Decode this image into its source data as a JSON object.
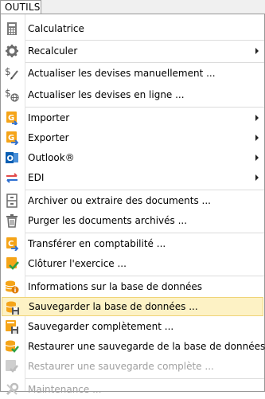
{
  "menubar": {
    "title": "OUTILS"
  },
  "items": [
    {
      "label": "Calculatrice",
      "icon": "calculator-icon",
      "submenu": false,
      "disabled": false
    },
    {
      "label": "Recalculer",
      "icon": "gear-icon",
      "submenu": true,
      "disabled": false
    },
    {
      "label": "Actualiser les devises manuellement ...",
      "icon": "currency-edit-icon",
      "submenu": false,
      "disabled": false
    },
    {
      "label": "Actualiser les devises en ligne ...",
      "icon": "currency-online-icon",
      "submenu": false,
      "disabled": false
    },
    {
      "label": "Importer",
      "icon": "import-icon",
      "submenu": true,
      "disabled": false
    },
    {
      "label": "Exporter",
      "icon": "export-icon",
      "submenu": true,
      "disabled": false
    },
    {
      "label": "Outlook®",
      "icon": "outlook-icon",
      "submenu": true,
      "disabled": false
    },
    {
      "label": "EDI",
      "icon": "edi-icon",
      "submenu": true,
      "disabled": false
    },
    {
      "label": "Archiver ou extraire des documents ...",
      "icon": "archive-icon",
      "submenu": false,
      "disabled": false
    },
    {
      "label": "Purger les documents archivés ...",
      "icon": "trash-icon",
      "submenu": false,
      "disabled": false
    },
    {
      "label": "Transférer en comptabilité ...",
      "icon": "transfer-accounting-icon",
      "submenu": false,
      "disabled": false
    },
    {
      "label": "Clôturer l'exercice ...",
      "icon": "close-fiscal-year-icon",
      "submenu": false,
      "disabled": false
    },
    {
      "label": "Informations sur la base de données",
      "icon": "database-info-icon",
      "submenu": false,
      "disabled": false
    },
    {
      "label": "Sauvegarder la base de données ...",
      "icon": "database-save-icon",
      "submenu": false,
      "disabled": false,
      "highlighted": true
    },
    {
      "label": "Sauvegarder complètement ...",
      "icon": "full-backup-icon",
      "submenu": false,
      "disabled": false
    },
    {
      "label": "Restaurer une sauvegarde de la base de données ...",
      "icon": "database-restore-icon",
      "submenu": false,
      "disabled": false
    },
    {
      "label": "Restaurer une sauvegarde complète ...",
      "icon": "full-restore-icon",
      "submenu": false,
      "disabled": true
    },
    {
      "label": "Maintenance ...",
      "icon": "wrench-icon",
      "submenu": false,
      "disabled": true
    }
  ],
  "colors": {
    "highlight_bg": "#fdf2c5",
    "highlight_border": "#efd478",
    "accent_orange": "#f5a418",
    "disabled_text": "#a0a0a0"
  }
}
